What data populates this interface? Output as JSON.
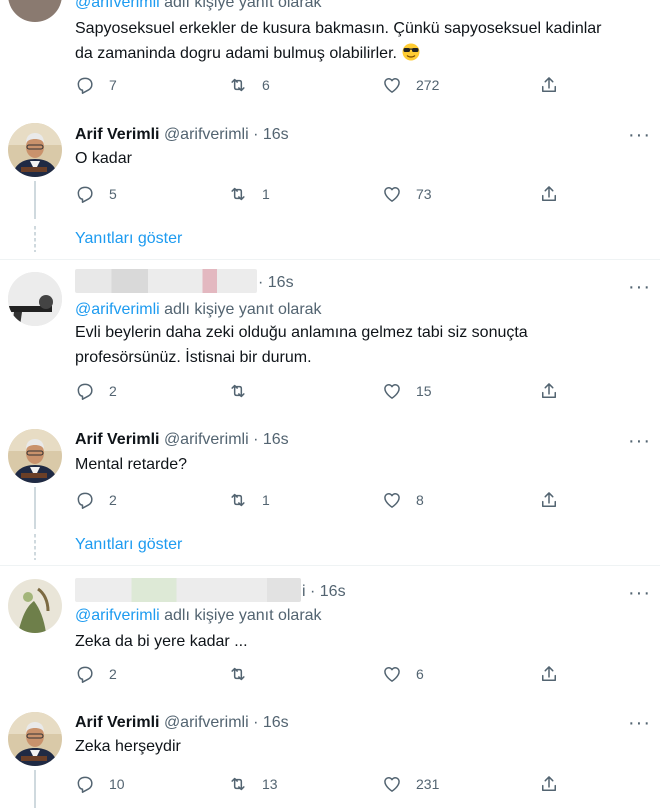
{
  "colors": {
    "accent": "#1d9bf0",
    "muted": "#536471",
    "text": "#0f1419",
    "divider": "#eff3f4"
  },
  "tweets": [
    {
      "reply_handle": "@arifverimli",
      "reply_suffix": " adlı kişiye yanıt olarak",
      "text": "Sapyoseksuel erkekler de kusura bakmasın.  Çünkü sapyoseksuel  kadinlar da zamaninda dogru adami bulmuş olabilirler.",
      "emoji": "sunglasses-emoji",
      "stats": {
        "replies": "7",
        "retweets": "6",
        "likes": "272"
      }
    },
    {
      "name": "Arif Verimli",
      "handle": "@arifverimli",
      "time": " · 16s",
      "text": "O kadar",
      "stats": {
        "replies": "5",
        "retweets": "1",
        "likes": "73"
      },
      "show_replies": "Yanıtları göster"
    },
    {
      "time": " · 16s",
      "reply_handle": "@arifverimli",
      "reply_suffix": " adlı kişiye yanıt olarak",
      "text": "Evli beylerin daha zeki olduğu anlamına gelmez tabi siz sonuçta profesörsünüz. İstisnai bir durum.",
      "stats": {
        "replies": "2",
        "retweets": "",
        "likes": "15"
      }
    },
    {
      "name": "Arif Verimli",
      "handle": "@arifverimli",
      "time": " · 16s",
      "text": "Mental retarde?",
      "stats": {
        "replies": "2",
        "retweets": "1",
        "likes": "8"
      },
      "show_replies": "Yanıtları göster"
    },
    {
      "time": "i · 16s",
      "reply_handle": "@arifverimli",
      "reply_suffix": " adlı kişiye yanıt olarak",
      "text": "Zeka da bi yere kadar ...",
      "stats": {
        "replies": "2",
        "retweets": "",
        "likes": "6"
      }
    },
    {
      "name": "Arif Verimli",
      "handle": "@arifverimli",
      "time": " · 16s",
      "text": "Zeka herşeydir",
      "stats": {
        "replies": "10",
        "retweets": "13",
        "likes": "231"
      }
    }
  ]
}
